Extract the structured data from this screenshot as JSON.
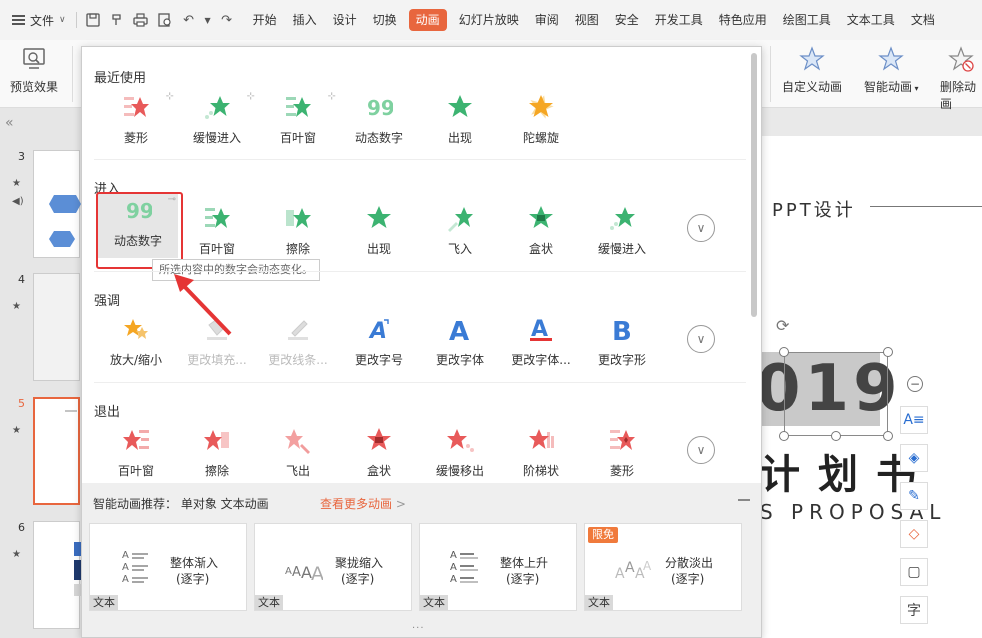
{
  "menubar": {
    "file_label": "文件",
    "tabs": [
      "开始",
      "插入",
      "设计",
      "切换",
      "动画",
      "幻灯片放映",
      "审阅",
      "视图",
      "安全",
      "开发工具",
      "特色应用",
      "绘图工具",
      "文本工具",
      "文档"
    ],
    "active_tab": "动画"
  },
  "ribbon": {
    "preview_label": "预览效果",
    "custom_anim_label": "自定义动画",
    "smart_anim_label": "智能动画",
    "delete_anim_label": "删除动画"
  },
  "leftpanel": {
    "slides": [
      {
        "num": "3"
      },
      {
        "num": "4"
      },
      {
        "num": "5"
      },
      {
        "num": "6"
      }
    ]
  },
  "canvas": {
    "ppt_title": "PPT设计",
    "year": "019",
    "plan": "计划书",
    "proposal": "S PROPOSAL"
  },
  "panel": {
    "sections": {
      "recent": {
        "title": "最近使用",
        "items": [
          "菱形",
          "缓慢进入",
          "百叶窗",
          "动态数字",
          "出现",
          "陀螺旋"
        ]
      },
      "enter": {
        "title": "进入",
        "items": [
          "动态数字",
          "百叶窗",
          "擦除",
          "出现",
          "飞入",
          "盒状",
          "缓慢进入"
        ]
      },
      "emphasis": {
        "title": "强调",
        "items": [
          "放大/缩小",
          "更改填充...",
          "更改线条...",
          "更改字号",
          "更改字体",
          "更改字体...",
          "更改字形"
        ]
      },
      "exit": {
        "title": "退出",
        "items": [
          "百叶窗",
          "擦除",
          "飞出",
          "盒状",
          "缓慢移出",
          "阶梯状",
          "菱形"
        ]
      }
    },
    "tooltip": "所选内容中的数字会动态变化。",
    "smart": {
      "header": "智能动画推荐：  单对象 文本动画",
      "more": "查看更多动画",
      "cards": [
        {
          "line1": "整体渐入",
          "line2": "(逐字)",
          "tag": "文本",
          "badge": ""
        },
        {
          "line1": "聚拢缩入",
          "line2": "(逐字)",
          "tag": "文本",
          "badge": ""
        },
        {
          "line1": "整体上升",
          "line2": "(逐字)",
          "tag": "文本",
          "badge": ""
        },
        {
          "line1": "分散淡出",
          "line2": "(逐字)",
          "tag": "文本",
          "badge": "限免"
        }
      ],
      "dots": "···"
    }
  },
  "colors": {
    "accent": "#e8663e",
    "highlight_box": "#e53535",
    "enter_green": "#3cb371",
    "exit_red": "#e85a5a",
    "emph_blue": "#3a7bd5"
  }
}
